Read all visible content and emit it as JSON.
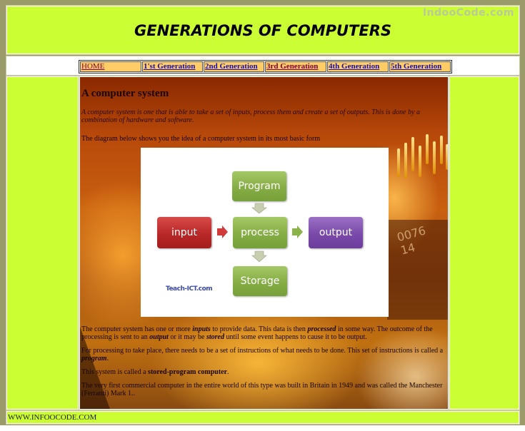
{
  "header": {
    "title": "GENERATIONS OF COMPUTERS",
    "watermark": "IndooCode.com"
  },
  "nav": {
    "items": [
      {
        "label": "HOME",
        "visited": true
      },
      {
        "label": "1'st Generation",
        "visited": false
      },
      {
        "label": "2nd Generation",
        "visited": false
      },
      {
        "label": "3rd Generation",
        "visited": true
      },
      {
        "label": "4th Generation",
        "visited": false
      },
      {
        "label": "5th Generation",
        "visited": false
      }
    ]
  },
  "content": {
    "heading": "A computer system",
    "intro": "A computer system is one that is able to take a set of inputs, process them and create a set of outputs. This is done by a combination of hardware and software.",
    "diagram_lead": "The diagram below shows you the idea of a computer system in its most basic form",
    "diagram": {
      "program": "Program",
      "input": "input",
      "process": "process",
      "output": "output",
      "storage": "Storage",
      "credit": "Teach-ICT.com",
      "colors": {
        "green": "#86ad45",
        "red": "#b82828",
        "purple": "#7a4aaa"
      }
    },
    "p1": {
      "a": "The computer system has one or more ",
      "inputs": "inputs",
      "b": " to provide data. This data is then ",
      "processed": "processed",
      "c": " in some way. The outcome of the processing is sent to an ",
      "output": "output",
      "d": " or it may be ",
      "stored": "stored",
      "e": " until some event happens to cause it to be output."
    },
    "p2": {
      "a": "For processing to take place, there needs to be a set of instructions of what needs to be done. This set of instructions is called a ",
      "program": "program",
      "b": "."
    },
    "p3": {
      "a": "This system is called a ",
      "bold": "stored-program computer",
      "b": "."
    },
    "p4": "The very first commercial computer in the entire world of this type was built in Britain in 1949 and was called the Manchester (Ferranti) Mark 1.."
  },
  "footer": {
    "text": "WWW.INFOOCODE.COM"
  },
  "colors": {
    "page_bg": "#ccff33",
    "frame": "#9a9a6a",
    "nav_item_bg": "#ffcc66"
  }
}
